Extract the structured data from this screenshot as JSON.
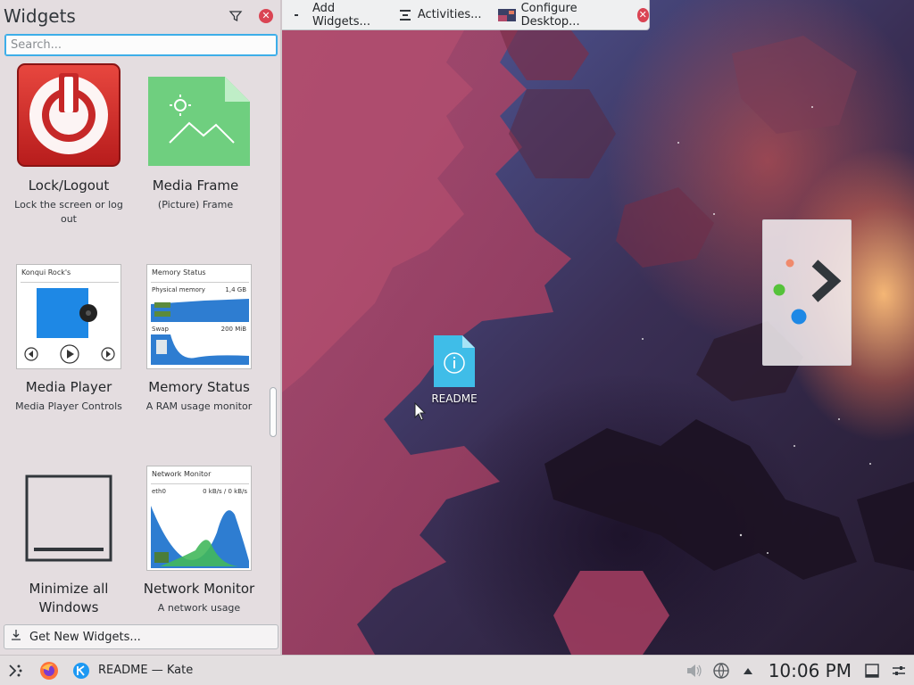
{
  "top_toolbar": {
    "add_widgets": "Add Widgets...",
    "activities": "Activities...",
    "configure_desktop": "Configure Desktop..."
  },
  "widgets_panel": {
    "title": "Widgets",
    "search_placeholder": "Search...",
    "items": [
      {
        "name": "Lock/Logout",
        "description": "Lock the screen or log out"
      },
      {
        "name": "Media Frame",
        "description": "(Picture) Frame"
      },
      {
        "name": "Media Player",
        "description": "Media Player Controls",
        "thumb_title": "Konqui Rock's"
      },
      {
        "name": "Memory Status",
        "description": "A RAM usage monitor",
        "thumb_title": "Memory Status",
        "physical_label": "Physical memory",
        "physical_value": "1,4 GB",
        "swap_label": "Swap",
        "swap_value": "200 MiB"
      },
      {
        "name": "Minimize all Windows",
        "description": ""
      },
      {
        "name": "Network Monitor",
        "description": "A network usage",
        "thumb_title": "Network Monitor",
        "iface": "eth0",
        "rate": "0 kB/s / 0 kB/s"
      }
    ],
    "get_new": "Get New Widgets..."
  },
  "desktop": {
    "readme_label": "README"
  },
  "taskbar": {
    "task_title": "README  — Kate",
    "clock": "10:06 PM"
  },
  "colors": {
    "accent": "#3daee9",
    "close_red": "#da4453",
    "panel_bg": "#e4dde0"
  }
}
